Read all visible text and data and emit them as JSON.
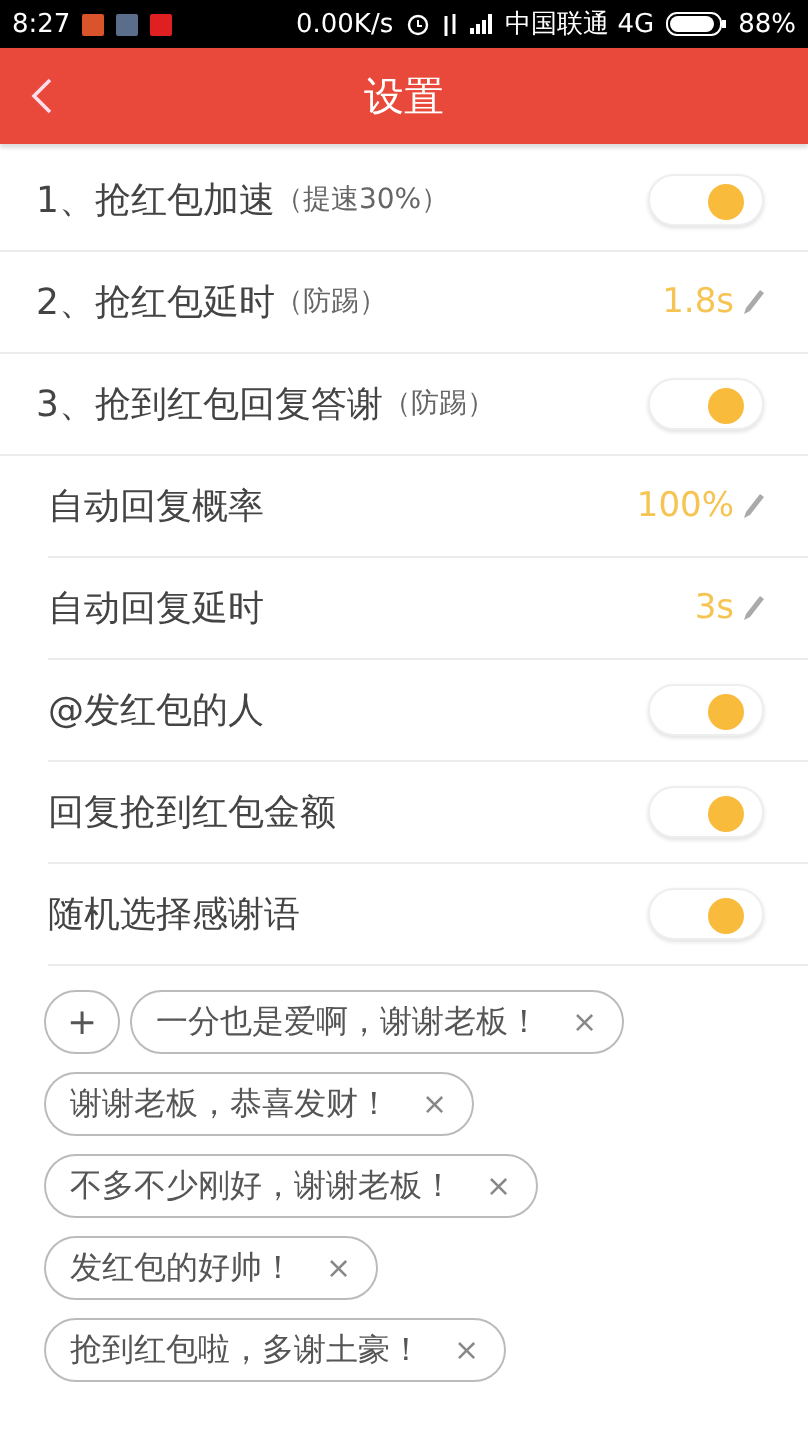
{
  "status_bar": {
    "time": "8:27",
    "speed": "0.00K/s",
    "carrier": "中国联通 4G",
    "battery": "88%"
  },
  "header": {
    "title": "设置"
  },
  "settings": [
    {
      "kind": "toggle",
      "label": "1、抢红包加速",
      "note": "（提速30%）",
      "on": true
    },
    {
      "kind": "value",
      "label": "2、抢红包延时",
      "note": "（防踢）",
      "value": "1.8s"
    },
    {
      "kind": "toggle",
      "label": "3、抢到红包回复答谢",
      "note": "（防踢）",
      "on": true,
      "children": [
        {
          "kind": "value",
          "label": "自动回复概率",
          "value": "100%"
        },
        {
          "kind": "value",
          "label": "自动回复延时",
          "value": "3s"
        },
        {
          "kind": "toggle",
          "label": "@发红包的人",
          "on": true
        },
        {
          "kind": "toggle",
          "label": "回复抢到红包金额",
          "on": true
        },
        {
          "kind": "toggle",
          "label": "随机选择感谢语",
          "on": true
        }
      ]
    }
  ],
  "phrases": {
    "add": "+",
    "remove": "×",
    "items": [
      "一分也是爱啊，谢谢老板！",
      "谢谢老板，恭喜发财！",
      "不多不少刚好，谢谢老板！",
      "发红包的好帅！",
      "抢到红包啦，多谢土豪！"
    ]
  }
}
